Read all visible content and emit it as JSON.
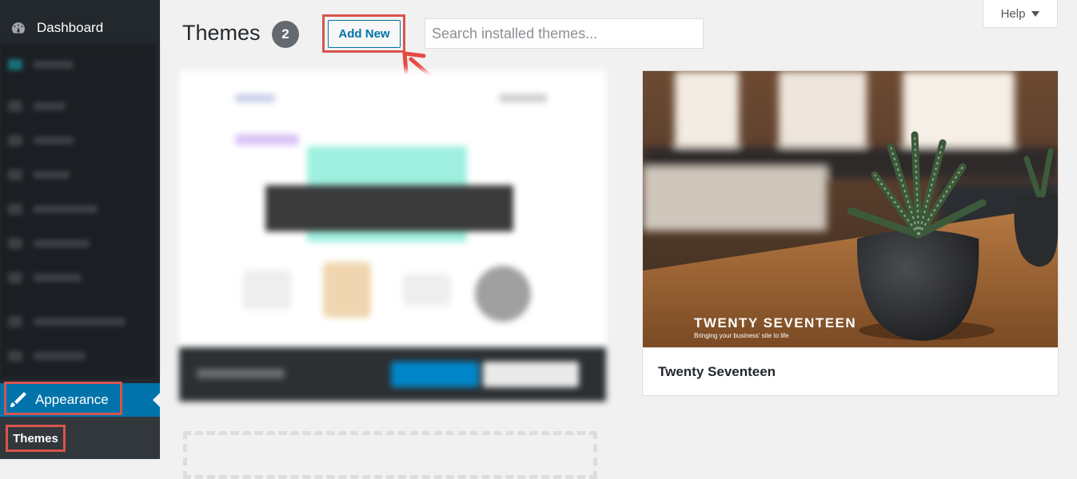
{
  "sidebar": {
    "dashboard_label": "Dashboard",
    "appearance_label": "Appearance",
    "themes_label": "Themes"
  },
  "header": {
    "title": "Themes",
    "count": "2",
    "add_new_label": "Add New",
    "search_placeholder": "Search installed themes...",
    "help_label": "Help"
  },
  "themes": [
    {
      "name": "Twenty Seventeen",
      "screenshot_title": "TWENTY SEVENTEEN",
      "screenshot_tagline": "Bringing your business' site to life"
    }
  ],
  "colors": {
    "sidebar_bg": "#23282d",
    "accent": "#0073aa",
    "highlight": "#d9534f"
  }
}
